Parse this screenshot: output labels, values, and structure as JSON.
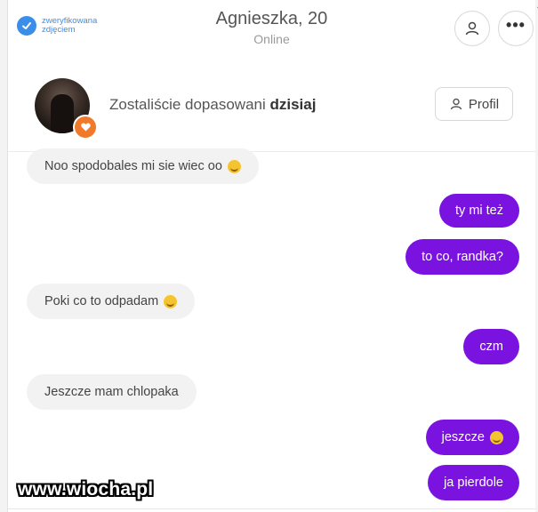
{
  "header": {
    "verified_line1": "zweryfikowana",
    "verified_line2": "zdjęciem",
    "title": "Agnieszka, 20",
    "status": "Online",
    "more_label": "•••"
  },
  "match": {
    "text_prefix": "Zostaliście dopasowani",
    "text_bold": "dzisiaj",
    "profile_button": "Profil"
  },
  "messages": [
    {
      "side": "in",
      "text": "Noo spodobales mi sie wiec oo",
      "emoji": "smile-emoji"
    },
    {
      "side": "out",
      "text": "ty mi też"
    },
    {
      "side": "out",
      "text": "to co, randka?"
    },
    {
      "side": "in",
      "text": "Poki co to odpadam",
      "emoji": "smile-emoji"
    },
    {
      "side": "out",
      "text": "czm"
    },
    {
      "side": "in",
      "text": "Jeszcze mam chlopaka"
    },
    {
      "side": "out",
      "text": "jeszcze",
      "emoji": "smile-emoji"
    },
    {
      "side": "out",
      "text": "ja pierdole"
    }
  ],
  "watermark": "www.wiocha.pl",
  "colors": {
    "accent": "#7a13e0",
    "verified_blue": "#3a8eea",
    "badge_orange": "#f07a2a",
    "incoming_bubble": "#f2f2f2"
  }
}
